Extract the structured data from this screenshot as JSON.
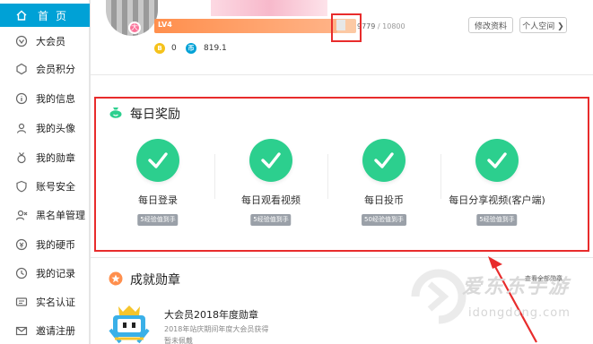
{
  "sidebar": {
    "items": [
      {
        "label": "首页",
        "icon": "home-icon",
        "active": true
      },
      {
        "label": "大会员",
        "icon": "vip-icon"
      },
      {
        "label": "会员积分",
        "icon": "points-icon"
      },
      {
        "label": "我的信息",
        "icon": "info-icon"
      },
      {
        "label": "我的头像",
        "icon": "avatar-icon"
      },
      {
        "label": "我的勋章",
        "icon": "medal-icon"
      },
      {
        "label": "账号安全",
        "icon": "shield-icon"
      },
      {
        "label": "黑名单管理",
        "icon": "blacklist-icon"
      },
      {
        "label": "我的硬币",
        "icon": "coin-icon"
      },
      {
        "label": "我的记录",
        "icon": "record-icon"
      },
      {
        "label": "实名认证",
        "icon": "id-card-icon"
      },
      {
        "label": "邀请注册",
        "icon": "invite-icon"
      }
    ]
  },
  "profile": {
    "level": "LV4",
    "exp_current": "9779",
    "exp_separator": "/",
    "exp_max": "10800",
    "exp_progress": 0.905,
    "coins": "0",
    "b_coin_label": "B",
    "hard_coins": "819.1",
    "hard_coin_label": "币",
    "avatar_badge": "大",
    "edit_button": "修改资料",
    "space_button": "个人空间 ❯"
  },
  "daily": {
    "title": "每日奖励",
    "tasks": [
      {
        "label": "每日登录",
        "reward": "5经验值到手"
      },
      {
        "label": "每日观看视频",
        "reward": "5经验值到手"
      },
      {
        "label": "每日投币",
        "reward": "50经验值到手"
      },
      {
        "label": "每日分享视频(客户端)",
        "reward": "5经验值到手"
      }
    ]
  },
  "achievements": {
    "title": "成就勋章",
    "view_all": "查看全部勋章",
    "badge_title": "大会员2018年度勋章",
    "badge_desc": "2018年站庆期间年度大会员获得",
    "badge_extra": "暂未佩戴"
  },
  "watermark": {
    "brand": "爱东东手游",
    "domain": "idongdong.com"
  },
  "colors": {
    "accent": "#00a1d6",
    "success": "#2ccf8e",
    "highlight_box": "#e82c2c",
    "level_bar": "#ff8f4d"
  }
}
